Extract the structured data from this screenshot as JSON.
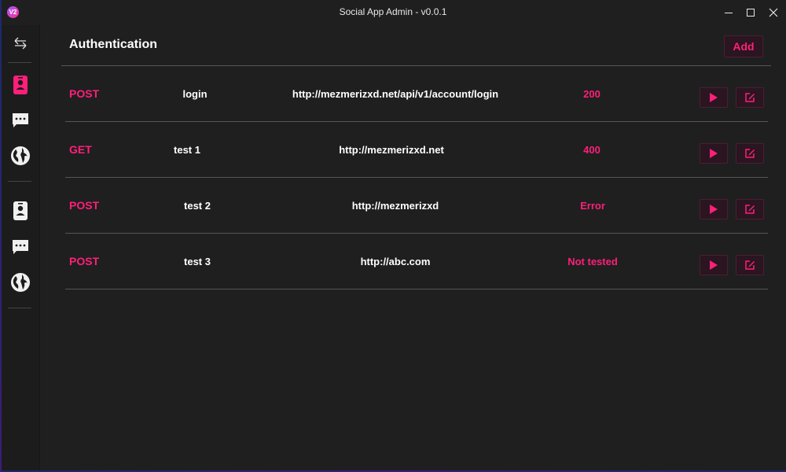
{
  "window": {
    "logo_text": "V2",
    "title": "Social App Admin - v0.0.1"
  },
  "sidebar": {
    "toggle_icon": "swap-arrows-icon",
    "groups": [
      {
        "items": [
          {
            "icon": "contact-card-icon",
            "active": true
          },
          {
            "icon": "chat-bubble-icon",
            "active": false
          },
          {
            "icon": "globe-icon",
            "active": false
          }
        ]
      },
      {
        "items": [
          {
            "icon": "contact-card-icon",
            "active": false
          },
          {
            "icon": "chat-bubble-icon",
            "active": false
          },
          {
            "icon": "globe-icon",
            "active": false
          }
        ]
      }
    ]
  },
  "main": {
    "title": "Authentication",
    "add_label": "Add",
    "requests": [
      {
        "method": "POST",
        "name": "login",
        "url": "http://mezmerizxd.net/api/v1/account/login",
        "status": "200"
      },
      {
        "method": "GET",
        "name": "test 1",
        "url": "http://mezmerizxd.net",
        "status": "400"
      },
      {
        "method": "POST",
        "name": "test 2",
        "url": "http://mezmerizxd",
        "status": "Error"
      },
      {
        "method": "POST",
        "name": "test 3",
        "url": "http://abc.com",
        "status": "Not tested"
      }
    ]
  },
  "colors": {
    "accent": "#ff1f7a",
    "background": "#1f1f1f",
    "button_bg": "#2a1520"
  }
}
